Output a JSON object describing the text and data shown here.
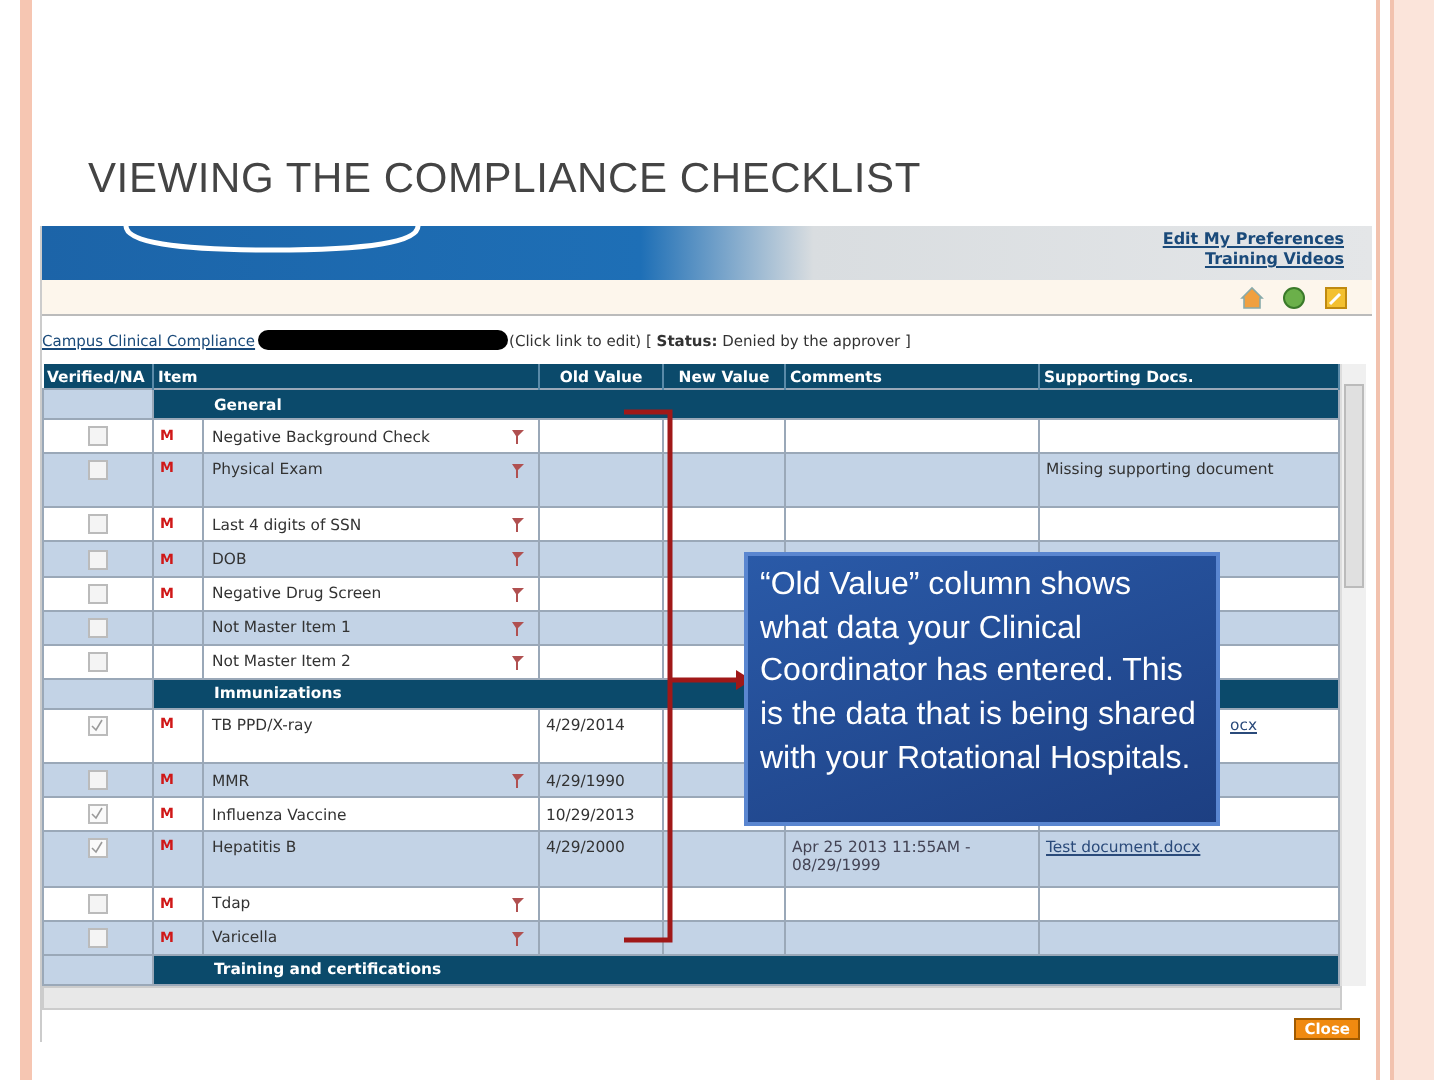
{
  "slide": {
    "title": "VIEWING THE COMPLIANCE CHECKLIST"
  },
  "header": {
    "links": [
      "Edit My Preferences",
      "Training Videos"
    ]
  },
  "status_line": {
    "link": "Campus Clinical Compliance",
    "redacted": true,
    "note": "(Click link to edit) [ **Status:** Denied by the approver ]"
  },
  "table": {
    "columns": [
      "Verified/NA",
      "Item",
      "Old Value",
      "New Value",
      "Comments",
      "Supporting Docs."
    ],
    "rows": [
      {
        "kind": "section",
        "label": "General"
      },
      {
        "kind": "item",
        "checked": false,
        "mark": "M",
        "item": "Negative Background Check",
        "flagged": true
      },
      {
        "kind": "item",
        "checked": false,
        "mark": "M",
        "item": "Physical Exam",
        "flagged": true,
        "supporting_text": "Missing supporting document"
      },
      {
        "kind": "item",
        "checked": false,
        "mark": "M",
        "item": "Last 4 digits of SSN",
        "flagged": true
      },
      {
        "kind": "item",
        "checked": false,
        "mark": "M",
        "item": "DOB",
        "flagged": true
      },
      {
        "kind": "item",
        "checked": false,
        "mark": "M",
        "item": "Negative Drug Screen",
        "flagged": true
      },
      {
        "kind": "item",
        "checked": false,
        "item": "Not Master Item 1",
        "flagged": true
      },
      {
        "kind": "item",
        "checked": false,
        "item": "Not Master Item 2",
        "flagged": true
      },
      {
        "kind": "section",
        "label": "Immunizations"
      },
      {
        "kind": "item",
        "checked": true,
        "mark": "M",
        "item": "TB PPD/X-ray",
        "flagged": false,
        "old_value": "4/29/2014",
        "supporting_link": "ocx"
      },
      {
        "kind": "item",
        "checked": false,
        "mark": "M",
        "item": "MMR",
        "flagged": true,
        "old_value": "4/29/1990"
      },
      {
        "kind": "item",
        "checked": true,
        "mark": "M",
        "item": "Influenza Vaccine",
        "flagged": false,
        "old_value": "10/29/2013"
      },
      {
        "kind": "item",
        "checked": true,
        "mark": "M",
        "item": "Hepatitis B",
        "flagged": false,
        "old_value": "4/29/2000",
        "comments": "Apr 25 2013 11:55AM - 08/29/1999",
        "supporting_link": "Test document.docx"
      },
      {
        "kind": "item",
        "checked": false,
        "mark": "M",
        "item": "Tdap",
        "flagged": true
      },
      {
        "kind": "item",
        "checked": false,
        "mark": "M",
        "item": "Varicella",
        "flagged": true
      },
      {
        "kind": "section",
        "label": "Training and certifications"
      }
    ]
  },
  "close_button": "Close",
  "callout": "“Old Value” column shows what data your Clinical Coordinator has entered. This is the data that is being shared with your Rotational Hospitals."
}
